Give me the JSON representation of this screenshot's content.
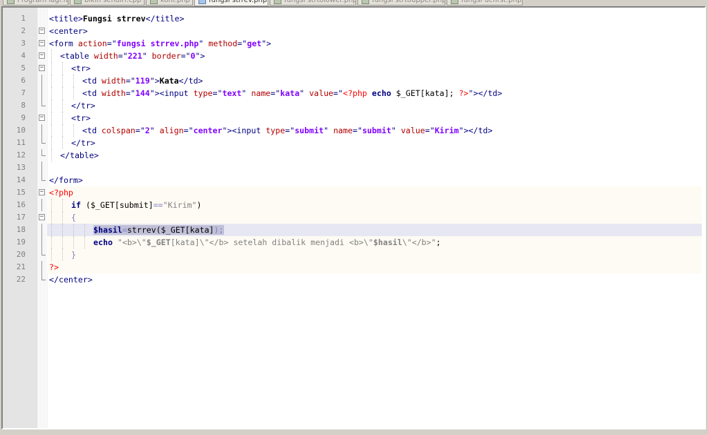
{
  "tabs": [
    {
      "label": "Program lagi.fb",
      "active": false
    },
    {
      "label": "bikin sendiri.cpp",
      "active": false
    },
    {
      "label": "koni.php",
      "active": false
    },
    {
      "label": "fungsi strrev.php",
      "active": true
    },
    {
      "label": "fungsi strtolower.php",
      "active": false
    },
    {
      "label": "fungsi strtoupper.php",
      "active": false
    },
    {
      "label": "fungsi ucfirst.php",
      "active": false
    }
  ],
  "editor": {
    "current_line": 18,
    "lines": [
      {
        "n": "1",
        "fold": "none",
        "indent": 0,
        "segments": [
          [
            "tag",
            "<title>"
          ],
          [
            "txt",
            "Fungsi strrev"
          ],
          [
            "tag",
            "</title>"
          ]
        ]
      },
      {
        "n": "2",
        "fold": "open",
        "indent": 0,
        "segments": [
          [
            "tag",
            "<center>"
          ]
        ]
      },
      {
        "n": "3",
        "fold": "open",
        "indent": 0,
        "segments": [
          [
            "tag",
            "<form "
          ],
          [
            "attr",
            "action"
          ],
          [
            "tag",
            "=\""
          ],
          [
            "val",
            "fungsi strrev.php"
          ],
          [
            "tag",
            "\" "
          ],
          [
            "attr",
            "method"
          ],
          [
            "tag",
            "=\""
          ],
          [
            "val",
            "get"
          ],
          [
            "tag",
            "\">"
          ]
        ]
      },
      {
        "n": "4",
        "fold": "open",
        "indent": 1,
        "segments": [
          [
            "tag",
            "<table "
          ],
          [
            "attr",
            "width"
          ],
          [
            "tag",
            "=\""
          ],
          [
            "val",
            "221"
          ],
          [
            "tag",
            "\" "
          ],
          [
            "attr",
            "border"
          ],
          [
            "tag",
            "=\""
          ],
          [
            "val",
            "0"
          ],
          [
            "tag",
            "\">"
          ]
        ]
      },
      {
        "n": "5",
        "fold": "open",
        "indent": 2,
        "segments": [
          [
            "tag",
            "<tr>"
          ]
        ]
      },
      {
        "n": "6",
        "fold": "line",
        "indent": 3,
        "segments": [
          [
            "tag",
            "<td "
          ],
          [
            "attr",
            "width"
          ],
          [
            "tag",
            "=\""
          ],
          [
            "val",
            "119"
          ],
          [
            "tag",
            "\">"
          ],
          [
            "txt",
            "Kata"
          ],
          [
            "tag",
            "</td>"
          ]
        ]
      },
      {
        "n": "7",
        "fold": "line",
        "indent": 3,
        "segments": [
          [
            "tag",
            "<td "
          ],
          [
            "attr",
            "width"
          ],
          [
            "tag",
            "=\""
          ],
          [
            "val",
            "144"
          ],
          [
            "tag",
            "\"><input "
          ],
          [
            "attr",
            "type"
          ],
          [
            "tag",
            "=\""
          ],
          [
            "val",
            "text"
          ],
          [
            "tag",
            "\" "
          ],
          [
            "attr",
            "name"
          ],
          [
            "tag",
            "=\""
          ],
          [
            "val",
            "kata"
          ],
          [
            "tag",
            "\" "
          ],
          [
            "attr",
            "value"
          ],
          [
            "tag",
            "=\""
          ],
          [
            "phpd",
            "<?php"
          ],
          [
            "plain",
            " "
          ],
          [
            "kw",
            "echo"
          ],
          [
            "plain",
            " $_GET[kata]; "
          ],
          [
            "phpd",
            "?>"
          ],
          [
            "tag",
            "\"></td>"
          ]
        ]
      },
      {
        "n": "8",
        "fold": "end",
        "indent": 2,
        "segments": [
          [
            "tag",
            "</tr>"
          ]
        ]
      },
      {
        "n": "9",
        "fold": "open",
        "indent": 2,
        "segments": [
          [
            "tag",
            "<tr>"
          ]
        ]
      },
      {
        "n": "10",
        "fold": "line",
        "indent": 3,
        "segments": [
          [
            "tag",
            "<td "
          ],
          [
            "attr",
            "colspan"
          ],
          [
            "tag",
            "=\""
          ],
          [
            "val",
            "2"
          ],
          [
            "tag",
            "\" "
          ],
          [
            "attr",
            "align"
          ],
          [
            "tag",
            "=\""
          ],
          [
            "val",
            "center"
          ],
          [
            "tag",
            "\"><input "
          ],
          [
            "attr",
            "type"
          ],
          [
            "tag",
            "=\""
          ],
          [
            "val",
            "submit"
          ],
          [
            "tag",
            "\" "
          ],
          [
            "attr",
            "name"
          ],
          [
            "tag",
            "=\""
          ],
          [
            "val",
            "submit"
          ],
          [
            "tag",
            "\" "
          ],
          [
            "attr",
            "value"
          ],
          [
            "tag",
            "=\""
          ],
          [
            "val",
            "Kirim"
          ],
          [
            "tag",
            "\"></td>"
          ]
        ]
      },
      {
        "n": "11",
        "fold": "end",
        "indent": 2,
        "segments": [
          [
            "tag",
            "</tr>"
          ]
        ]
      },
      {
        "n": "12",
        "fold": "end",
        "indent": 1,
        "segments": [
          [
            "tag",
            "</table>"
          ]
        ]
      },
      {
        "n": "13",
        "fold": "line",
        "indent": 0,
        "segments": []
      },
      {
        "n": "14",
        "fold": "end",
        "indent": 0,
        "segments": [
          [
            "tag",
            "</form>"
          ]
        ]
      },
      {
        "n": "15",
        "fold": "open",
        "indent": 0,
        "php": true,
        "segments": [
          [
            "phpd",
            "<?php"
          ]
        ]
      },
      {
        "n": "16",
        "fold": "line",
        "indent": 2,
        "php": true,
        "segments": [
          [
            "kw",
            "if"
          ],
          [
            "plain",
            " ("
          ],
          [
            "plain",
            "$_GET[submit]"
          ],
          [
            "op",
            "=="
          ],
          [
            "str",
            "\"Kirim\""
          ],
          [
            "plain",
            ")"
          ]
        ]
      },
      {
        "n": "17",
        "fold": "open",
        "indent": 2,
        "php": true,
        "segments": [
          [
            "op",
            "{"
          ]
        ]
      },
      {
        "n": "18",
        "fold": "line",
        "indent": 4,
        "php": true,
        "segments": [
          [
            "selvar",
            "$hasil"
          ],
          [
            "selop",
            "="
          ],
          [
            "selplain",
            "strrev("
          ],
          [
            "selplain",
            "$_GET[kata]"
          ],
          [
            "selop",
            ");"
          ]
        ]
      },
      {
        "n": "19",
        "fold": "line",
        "indent": 4,
        "php": true,
        "segments": [
          [
            "kw",
            "echo"
          ],
          [
            "plain",
            " "
          ],
          [
            "str",
            "\"<b>\\\""
          ],
          [
            "strb",
            "$_GET"
          ],
          [
            "str",
            "[kata]\\\"</b> setelah dibalik menjadi <b>\\\""
          ],
          [
            "strb",
            "$hasil"
          ],
          [
            "str",
            "\\\"</b>\""
          ],
          [
            "plain",
            ";"
          ]
        ]
      },
      {
        "n": "20",
        "fold": "end",
        "indent": 2,
        "php": true,
        "segments": [
          [
            "op",
            "}"
          ]
        ]
      },
      {
        "n": "21",
        "fold": "line",
        "indent": 0,
        "php": true,
        "segments": [
          [
            "phpd",
            "?>"
          ]
        ]
      },
      {
        "n": "22",
        "fold": "end",
        "indent": 0,
        "segments": [
          [
            "tag",
            "</center>"
          ]
        ]
      }
    ]
  }
}
